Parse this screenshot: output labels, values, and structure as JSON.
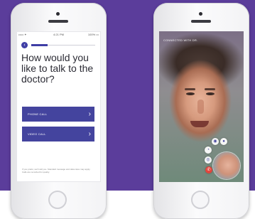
{
  "left_screen": {
    "status_bar": {
      "carrier": "••••• ✦",
      "time": "4:21 PM",
      "battery": "100% ▭"
    },
    "back_icon": "back-arrow-icon",
    "progress": 0.25,
    "question": "How would you like to talk to the doctor?",
    "options": [
      {
        "label": "PHONE CALL",
        "icon": "chevron-right-icon"
      },
      {
        "label": "VIDEO CALL",
        "icon": "chevron-right-icon"
      }
    ],
    "disclaimer": "If you prefer, we'll call you. Standard message and data rates may apply. Calls are recorded for quality."
  },
  "right_screen": {
    "caller_label": "CONNECTED WITH DR.",
    "controls": [
      {
        "icon": "camera-switch-icon",
        "glyph": "◉"
      },
      {
        "icon": "chat-icon",
        "glyph": "●"
      },
      {
        "icon": "mute-icon",
        "glyph": "◔"
      },
      {
        "icon": "speaker-icon",
        "glyph": "◎"
      },
      {
        "icon": "end-call-icon",
        "glyph": "✆"
      }
    ]
  },
  "colors": {
    "background_purple": "#5b3d9b",
    "button_blue": "#44449e",
    "end_call_red": "#e2453c"
  }
}
